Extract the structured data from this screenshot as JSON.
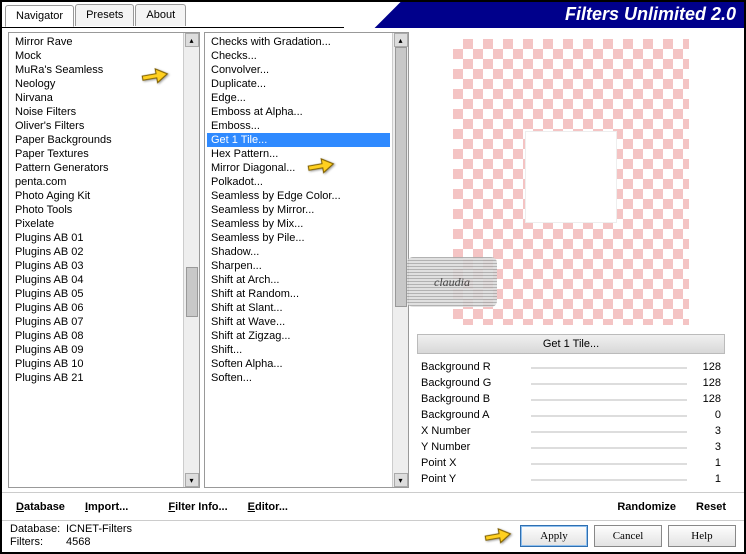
{
  "tabs": {
    "navigator": "Navigator",
    "presets": "Presets",
    "about": "About"
  },
  "title": "Filters Unlimited 2.0",
  "list1": [
    "Mirror Rave",
    "Mock",
    "MuRa's Seamless",
    "Neology",
    "Nirvana",
    "Noise Filters",
    "Oliver's Filters",
    "Paper Backgrounds",
    "Paper Textures",
    "Pattern Generators",
    "penta.com",
    "Photo Aging Kit",
    "Photo Tools",
    "Pixelate",
    "Plugins AB 01",
    "Plugins AB 02",
    "Plugins AB 03",
    "Plugins AB 04",
    "Plugins AB 05",
    "Plugins AB 06",
    "Plugins AB 07",
    "Plugins AB 08",
    "Plugins AB 09",
    "Plugins AB 10",
    "Plugins AB 21"
  ],
  "list1_highlight_index": 2,
  "list2": [
    "Checks with Gradation...",
    "Checks...",
    "Convolver...",
    "Duplicate...",
    "Edge...",
    "Emboss at Alpha...",
    "Emboss...",
    "Get 1 Tile...",
    "Hex Pattern...",
    "Mirror Diagonal...",
    "Polkadot...",
    "Seamless by Edge Color...",
    "Seamless by Mirror...",
    "Seamless by Mix...",
    "Seamless by Pile...",
    "Shadow...",
    "Sharpen...",
    "Shift at Arch...",
    "Shift at Random...",
    "Shift at Slant...",
    "Shift at Wave...",
    "Shift at Zigzag...",
    "Shift...",
    "Soften Alpha...",
    "Soften..."
  ],
  "list2_selected_index": 7,
  "filter_title": "Get 1 Tile...",
  "params": [
    {
      "label": "Background R",
      "val": "128"
    },
    {
      "label": "Background G",
      "val": "128"
    },
    {
      "label": "Background B",
      "val": "128"
    },
    {
      "label": "Background A",
      "val": "0"
    },
    {
      "label": "X Number",
      "val": "3"
    },
    {
      "label": "Y Number",
      "val": "3"
    },
    {
      "label": "Point X",
      "val": "1"
    },
    {
      "label": "Point Y",
      "val": "1"
    }
  ],
  "links": {
    "database": "Database",
    "import": "Import...",
    "filterinfo": "Filter Info...",
    "editor": "Editor...",
    "randomize": "Randomize",
    "reset": "Reset"
  },
  "status": {
    "db_label": "Database:",
    "db_val": "ICNET-Filters",
    "filters_label": "Filters:",
    "filters_val": "4568"
  },
  "buttons": {
    "apply": "Apply",
    "cancel": "Cancel",
    "help": "Help"
  },
  "watermark": "claudia"
}
